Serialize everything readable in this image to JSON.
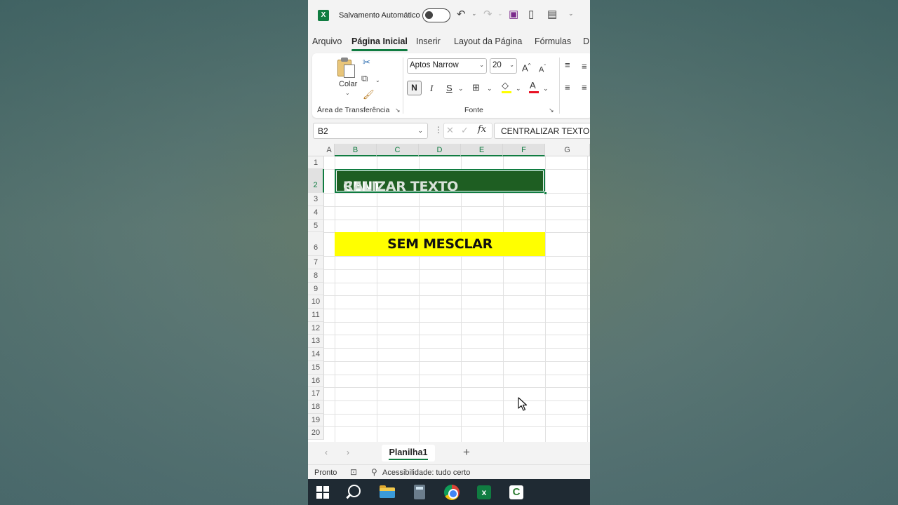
{
  "titlebar": {
    "autosave_label": "Salvamento Automático",
    "autosave_on": false,
    "icons": [
      "excel-icon",
      "undo-icon",
      "redo-icon",
      "save-icon",
      "new-file-icon",
      "form-icon",
      "customize-icon"
    ]
  },
  "menu": {
    "tabs": [
      "Arquivo",
      "Página Inicial",
      "Inserir",
      "Layout da Página",
      "Fórmulas",
      "D"
    ],
    "active": "Página Inicial"
  },
  "ribbon": {
    "clipboard": {
      "paste_label": "Colar",
      "group_label": "Área de Transferência"
    },
    "font": {
      "font_name": "Aptos Narrow",
      "font_size": "20",
      "bold_label": "N",
      "italic_label": "I",
      "underline_label": "S",
      "grow_label": "A",
      "shrink_label": "A",
      "font_color_label": "A",
      "group_label": "Fonte",
      "fill_color": "#ffff00",
      "font_color": "#e81123"
    }
  },
  "formula_bar": {
    "name_box": "B2",
    "fx_label": "fx",
    "content": "CENTRALIZAR TEXTO"
  },
  "grid": {
    "columns": [
      "A",
      "B",
      "C",
      "D",
      "E",
      "F",
      "G"
    ],
    "selected_columns": [
      "B",
      "C",
      "D",
      "E",
      "F"
    ],
    "rows": [
      "1",
      "2",
      "3",
      "4",
      "5",
      "6",
      "7",
      "8",
      "9",
      "10",
      "11",
      "12",
      "13",
      "14",
      "15",
      "16",
      "17",
      "18",
      "19",
      "20"
    ],
    "selected_row": "2",
    "cells": {
      "b2_part1": "CENT",
      "b2_part2": "RALIZAR TEXTO",
      "b2_fill": "#1e5e22",
      "b6": "SEM MESCLAR",
      "b6_fill": "#ffff00"
    }
  },
  "sheets": {
    "tabs": [
      "Planilha1"
    ],
    "add_label": "+"
  },
  "status": {
    "ready": "Pronto",
    "accessibility": "Acessibilidade: tudo certo"
  },
  "taskbar": {
    "apps": [
      "windows-start-icon",
      "search-icon",
      "file-explorer-icon",
      "calculator-icon",
      "chrome-icon",
      "excel-icon",
      "camtasia-icon"
    ],
    "active_app": "excel-icon"
  },
  "colors": {
    "accent": "#107c41",
    "app_bg": "#f3f3f3",
    "taskbar_bg": "#1f2a33"
  }
}
